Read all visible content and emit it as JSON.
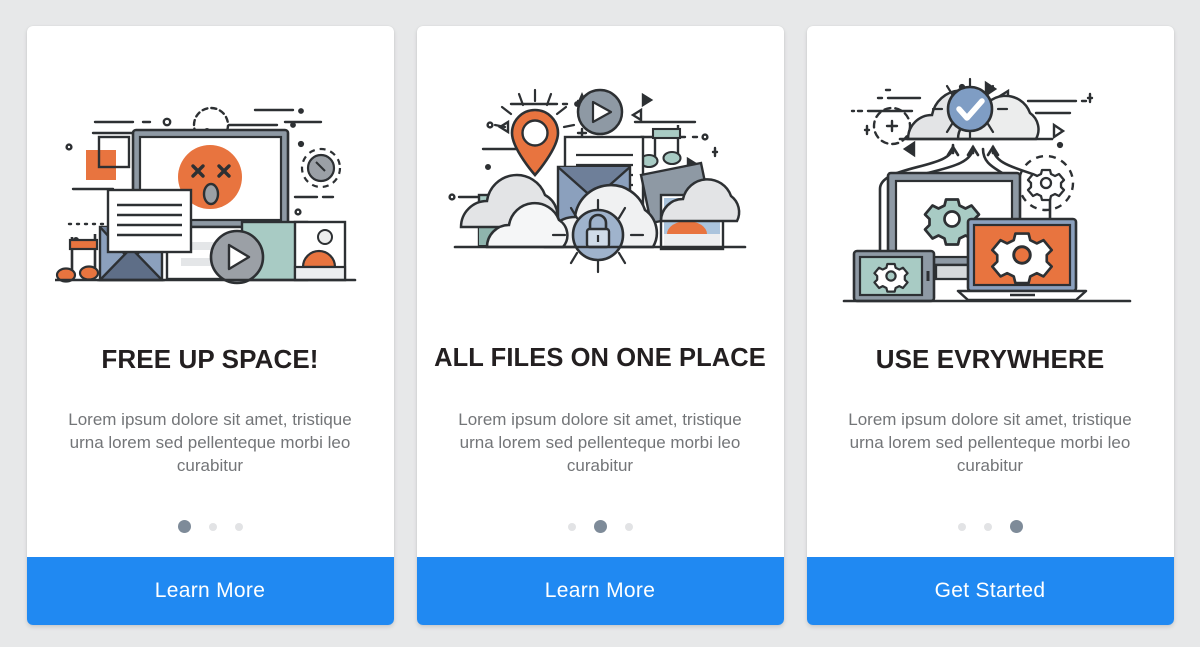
{
  "theme": {
    "background": "#e7e8e9",
    "card_background": "#ffffff",
    "accent_blue": "#2089f2",
    "accent_orange": "#e8743f",
    "title_color": "#231f20",
    "body_color": "#737578",
    "dot_active": "#7e8b99",
    "dot_inactive": "#e2e3e5",
    "line_color": "#2d3033",
    "teal": "#a8cbc4",
    "slate_blue": "#8ba0bd",
    "gray_cloud": "#e3e4e6"
  },
  "slides": [
    {
      "id": "free-up-space",
      "illustration": "broken-monitor-media-illustration",
      "illustration_items": [
        "monitor-icon",
        "dead-face-icon",
        "envelope-icon",
        "document-icon",
        "music-note-icon",
        "play-button-icon",
        "photo-icon",
        "square-decoration"
      ],
      "title": "FREE UP SPACE!",
      "body": "Lorem ipsum dolore sit amet, tristique urna lorem sed pellenteque morbi leo curabitur",
      "dots": {
        "count": 3,
        "active_index": 0
      },
      "cta_label": "Learn More"
    },
    {
      "id": "all-files-on-one-place",
      "illustration": "cloud-storage-media-illustration",
      "illustration_items": [
        "cloud-icon",
        "location-pin-icon",
        "lock-icon",
        "play-button-icon",
        "music-note-icon",
        "document-icon",
        "envelope-icon",
        "photo-icon"
      ],
      "title": "ALL FILES ON ONE PLACE",
      "body": "Lorem ipsum dolore sit amet, tristique urna lorem sed pellenteque morbi leo curabitur",
      "dots": {
        "count": 3,
        "active_index": 1
      },
      "cta_label": "Learn More"
    },
    {
      "id": "use-everywhere",
      "illustration": "multi-device-sync-illustration",
      "illustration_items": [
        "cloud-icon",
        "check-badge-icon",
        "upload-arrow-icon",
        "monitor-icon",
        "laptop-icon",
        "tablet-icon",
        "gear-icon"
      ],
      "title": "USE EVRYWHERE",
      "body": "Lorem ipsum dolore sit amet, tristique urna lorem sed pellenteque morbi leo curabitur",
      "dots": {
        "count": 3,
        "active_index": 2
      },
      "cta_label": "Get Started"
    }
  ]
}
